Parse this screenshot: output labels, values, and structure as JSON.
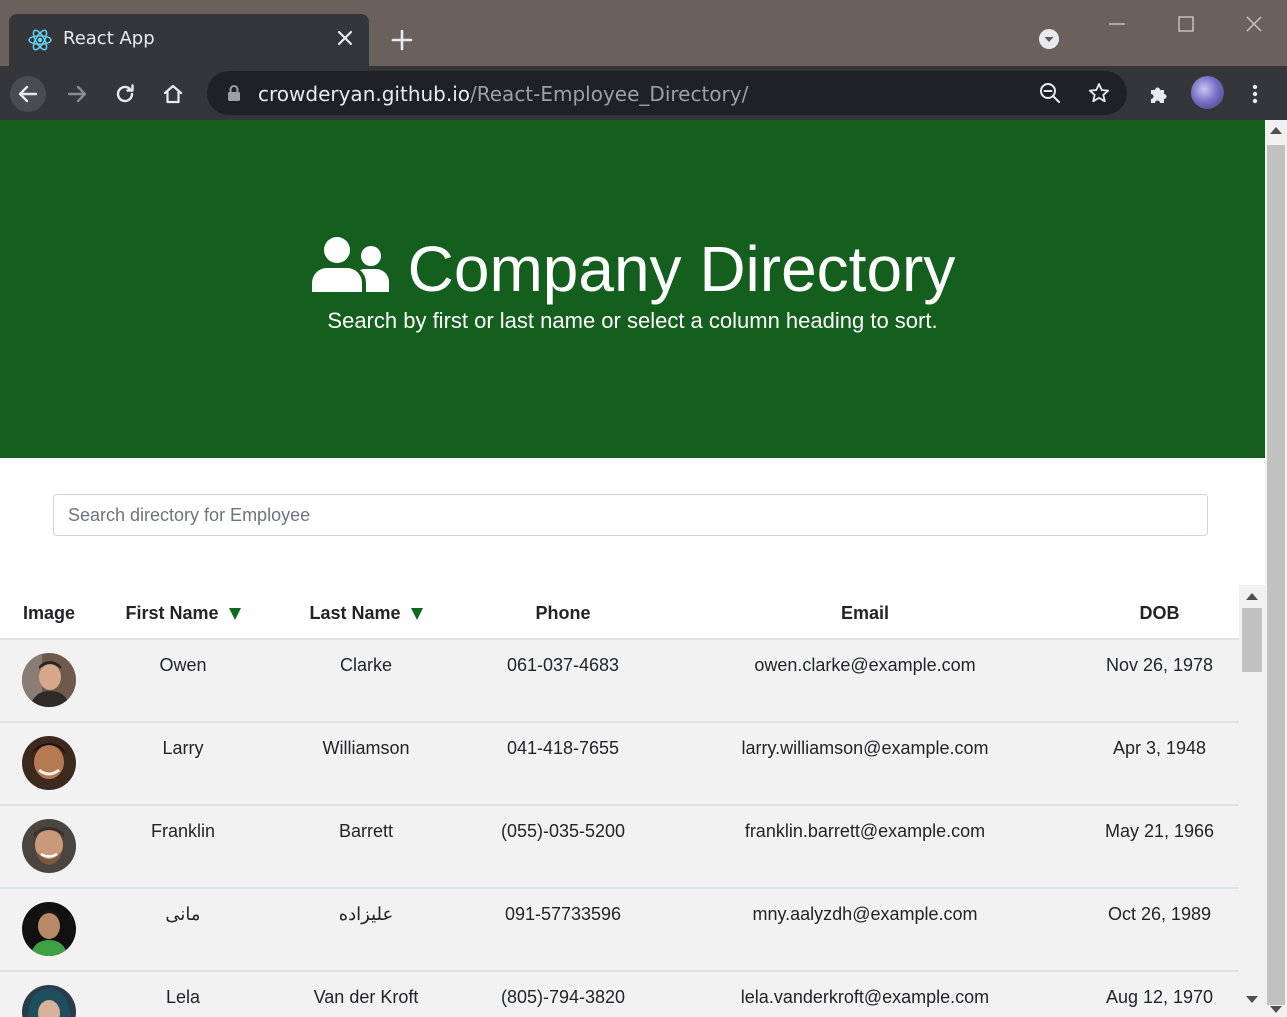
{
  "browser": {
    "tab_title": "React App",
    "url_host": "crowderyan.github.io",
    "url_path": "/React-Employee_Directory/"
  },
  "hero": {
    "title": "Company Directory",
    "subtitle": "Search by first or last name or select a column heading to sort.",
    "icon": "users-icon",
    "background": "#145f1e"
  },
  "search": {
    "placeholder": "Search directory for Employee",
    "value": ""
  },
  "table": {
    "headers": {
      "image": "Image",
      "first_name": "First Name",
      "last_name": "Last Name",
      "phone": "Phone",
      "email": "Email",
      "dob": "DOB"
    },
    "sort_arrow_color": "#0f6a1c",
    "rows": [
      {
        "first": "Owen",
        "last": "Clarke",
        "phone": "061-037-4683",
        "email": "owen.clarke@example.com",
        "dob": "Nov 26, 1978"
      },
      {
        "first": "Larry",
        "last": "Williamson",
        "phone": "041-418-7655",
        "email": "larry.williamson@example.com",
        "dob": "Apr 3, 1948"
      },
      {
        "first": "Franklin",
        "last": "Barrett",
        "phone": "(055)-035-5200",
        "email": "franklin.barrett@example.com",
        "dob": "May 21, 1966"
      },
      {
        "first": "مانی",
        "last": "علیزاده",
        "phone": "091-57733596",
        "email": "mny.aalyzdh@example.com",
        "dob": "Oct 26, 1989"
      },
      {
        "first": "Lela",
        "last": "Van der Kroft",
        "phone": "(805)-794-3820",
        "email": "lela.vanderkroft@example.com",
        "dob": "Aug 12, 1970"
      }
    ]
  }
}
